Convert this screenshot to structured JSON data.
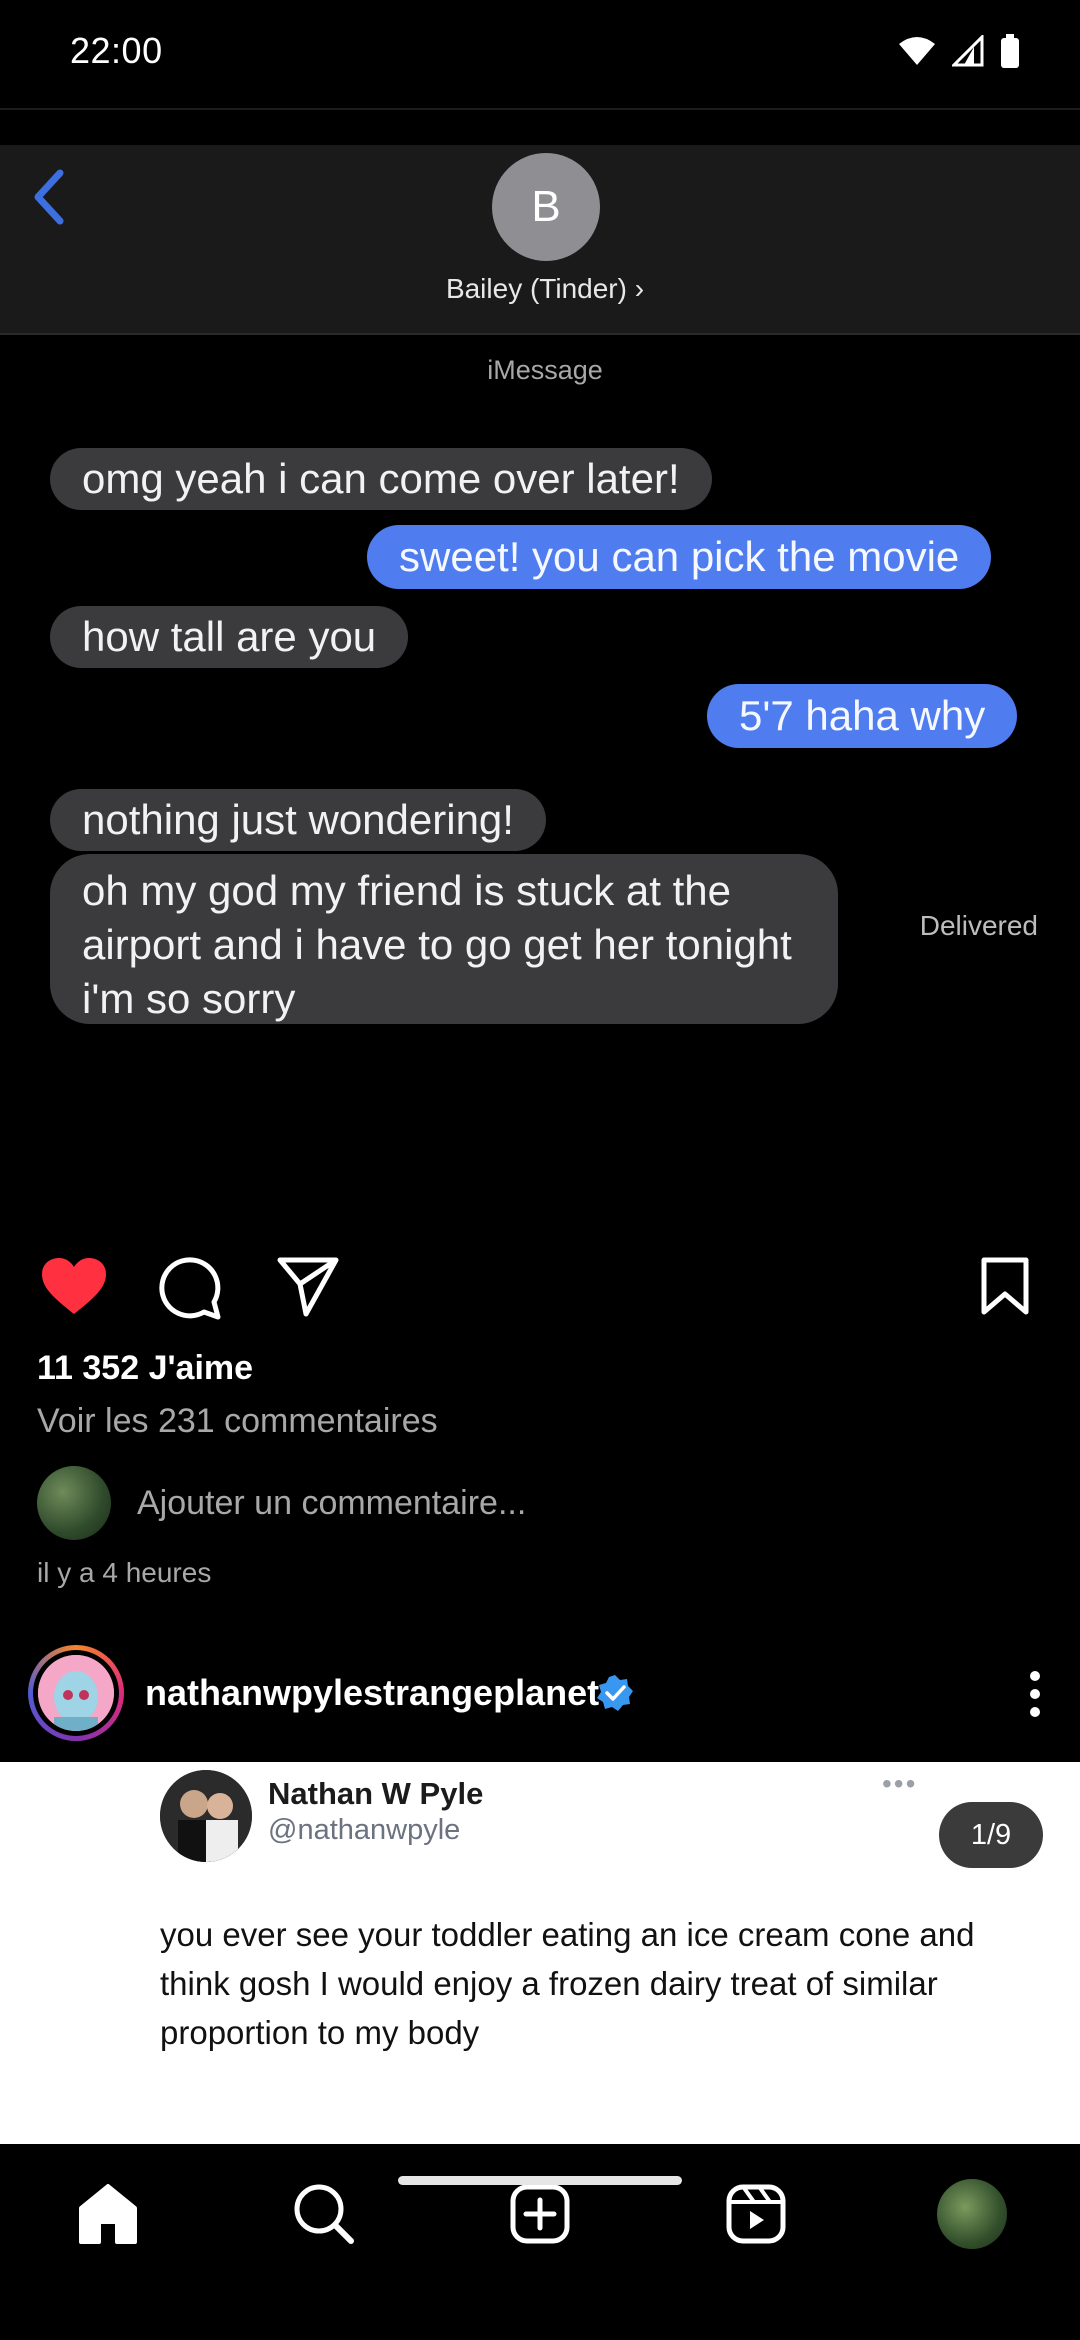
{
  "status_bar": {
    "time": "22:00"
  },
  "post1": {
    "image": {
      "contact_initial": "B",
      "contact_name": "Bailey (Tinder)",
      "contact_chevron": "›",
      "service": "iMessage",
      "messages": [
        {
          "direction": "in",
          "text": "omg yeah i can come over later!"
        },
        {
          "direction": "out",
          "text": "sweet! you can pick the movie"
        },
        {
          "direction": "in",
          "text": "how tall are you"
        },
        {
          "direction": "out",
          "text": "5'7 haha why"
        },
        {
          "direction": "in",
          "text": "nothing just wondering!"
        },
        {
          "direction": "in",
          "text": "oh my god my friend is stuck at the airport and i have to go get her tonight i'm so sorry"
        }
      ],
      "delivered_label": "Delivered"
    },
    "likes": "11 352 J'aime",
    "view_comments": "Voir les 231 commentaires",
    "add_comment_placeholder": "Ajouter un commentaire...",
    "timestamp": "il y a 4 heures"
  },
  "post2": {
    "username": "nathanwpylestrangeplanet",
    "tweet": {
      "name": "Nathan W Pyle",
      "handle": "@nathanwpyle",
      "menu": "•••",
      "text": "you ever see your toddler eating an ice cream cone and think gosh I would enjoy a frozen dairy treat of similar proportion to my body"
    },
    "counter": "1/9"
  },
  "icons": {
    "like": "heart-icon",
    "comment": "comment-icon",
    "share": "send-icon",
    "save": "bookmark-icon",
    "home": "home-icon",
    "search": "search-icon",
    "create": "add-icon",
    "reels": "reels-icon"
  },
  "colors": {
    "like_red": "#ff3040",
    "imessage_blue": "#4f7df0",
    "verified_blue": "#3897f0"
  }
}
